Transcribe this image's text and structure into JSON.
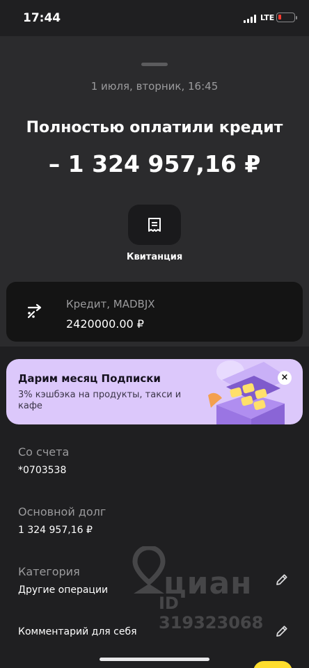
{
  "status_bar": {
    "time": "17:44",
    "network": "LTE",
    "battery_color": "#ff3b30"
  },
  "header": {
    "date": "1 июля, вторник, 16:45",
    "title": "Полностью оплатили кредит",
    "amount": "– 1 324 957,16 ₽"
  },
  "receipt": {
    "label": "Квитанция",
    "icon": "receipt-icon"
  },
  "credit": {
    "icon": "transfer-icon",
    "name": "Кредит, MADBJX",
    "sum": "2420000.00 ₽"
  },
  "promo": {
    "title": "Дарим месяц Подписки",
    "description": "3% кэшбэка на продукты, такси и кафе",
    "close_label": "×",
    "background": "#dcc8fb"
  },
  "details": {
    "account_label": "Со счета",
    "account_value": "*0703538",
    "debt_label": "Основной долг",
    "debt_value": "1 324 957,16 ₽",
    "category_label": "Категория",
    "category_value": "Другие операции",
    "comment_label": "Комментарий для себя"
  },
  "watermark": {
    "brand": "циан",
    "id": "ID 319323068"
  }
}
